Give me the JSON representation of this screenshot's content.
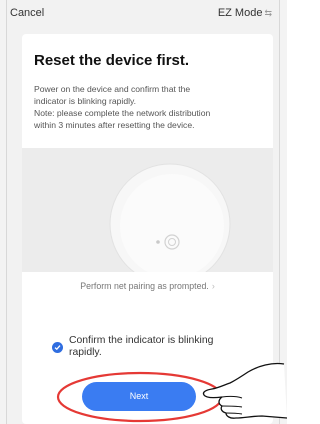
{
  "header": {
    "cancel_label": "Cancel",
    "mode_label": "EZ Mode",
    "mode_icon": "switch-icon"
  },
  "main": {
    "title": "Reset the device first.",
    "description_lines": [
      "Power on the device and confirm that the",
      "indicator is blinking rapidly.",
      "Note: please complete the network distribution",
      "within 3 minutes after resetting the device."
    ],
    "pairing_link": "Perform net pairing as prompted.",
    "confirm_lines": [
      "Confirm the indicator is blinking",
      "rapidly."
    ],
    "confirm_checked": true,
    "next_label": "Next"
  },
  "colors": {
    "accent": "#3a7cf2",
    "annotation": "#e53935"
  }
}
